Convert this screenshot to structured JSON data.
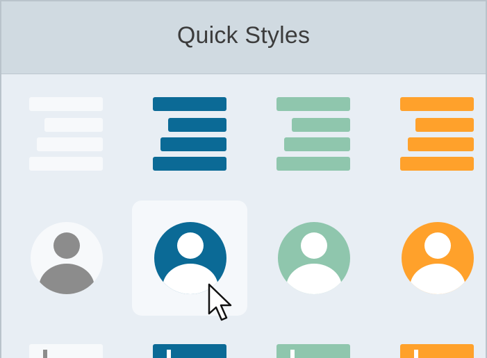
{
  "panel": {
    "title": "Quick Styles"
  },
  "colors": {
    "white": "#f7f9fb",
    "gray": "#8c8c8c",
    "blue": "#0b6a96",
    "teal": "#8fc6ad",
    "orange": "#ffa12b",
    "hover_bg": "#f5f8fb"
  },
  "styles_row1": [
    {
      "name": "list-style-white",
      "icon": "list-icon",
      "color": "white"
    },
    {
      "name": "list-style-blue",
      "icon": "list-icon",
      "color": "blue"
    },
    {
      "name": "list-style-teal",
      "icon": "list-icon",
      "color": "teal"
    },
    {
      "name": "list-style-orange",
      "icon": "list-icon",
      "color": "orange"
    }
  ],
  "styles_row2": [
    {
      "name": "avatar-style-gray",
      "icon": "user-icon",
      "color": "gray"
    },
    {
      "name": "avatar-style-blue",
      "icon": "user-icon",
      "color": "blue",
      "hovered": true
    },
    {
      "name": "avatar-style-teal",
      "icon": "user-icon",
      "color": "teal"
    },
    {
      "name": "avatar-style-orange",
      "icon": "user-icon",
      "color": "orange"
    }
  ],
  "styles_row3": [
    {
      "name": "partial-style-white",
      "color": "white"
    },
    {
      "name": "partial-style-blue",
      "color": "blue"
    },
    {
      "name": "partial-style-teal",
      "color": "teal"
    },
    {
      "name": "partial-style-orange",
      "color": "orange"
    }
  ]
}
